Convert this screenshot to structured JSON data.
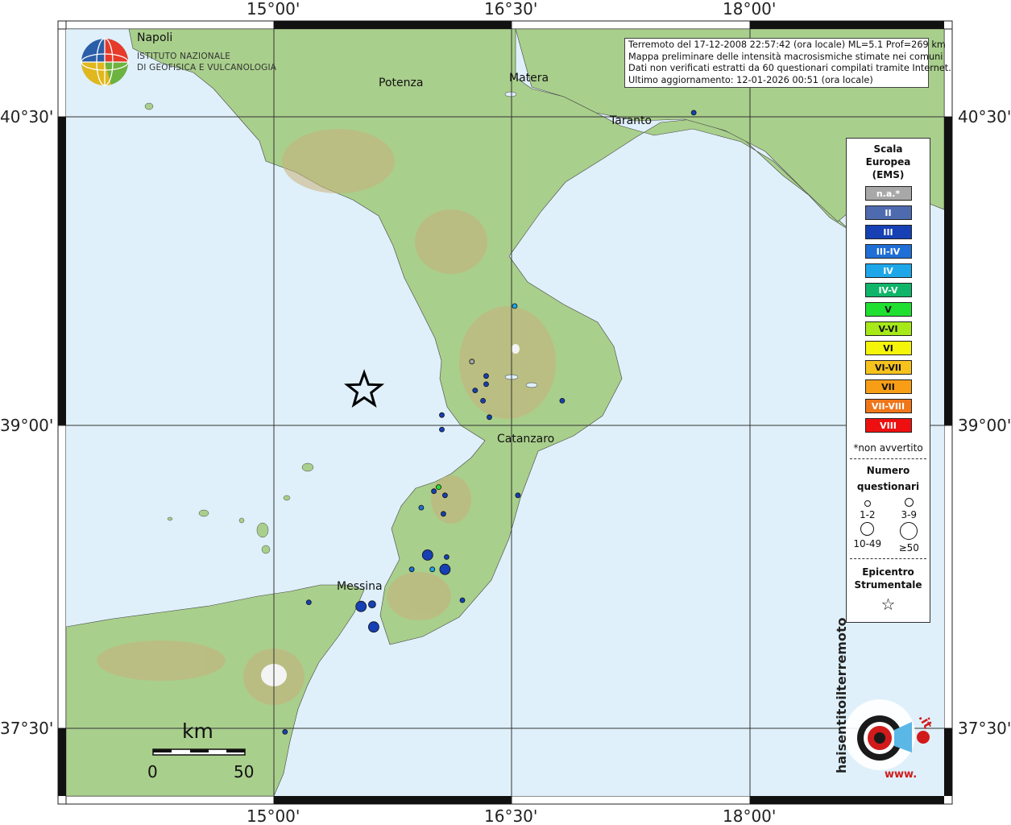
{
  "map": {
    "top_labels": [
      "15°00'",
      "16°30'",
      "18°00'"
    ],
    "bottom_labels": [
      "15°00'",
      "16°30'",
      "18°00'"
    ],
    "left_labels": [
      "40°30'",
      "39°00'",
      "37°30'"
    ],
    "right_labels": [
      "40°30'",
      "39°00'",
      "37°30'"
    ],
    "cities": [
      "Napoli",
      "Potenza",
      "Matera",
      "Taranto",
      "Catanzaro",
      "Messina"
    ],
    "colors": {
      "sea": "#dff0fa",
      "land": "#a9cf8c",
      "highland": "#c9b07a",
      "grid": "#333333",
      "epicenter": "#000000"
    }
  },
  "header": {
    "line1": "Terremoto del 17-12-2008 22:57:42 (ora locale) ML=5.1 Prof=269 km",
    "line2": "Mappa preliminare delle intensità macrosismiche stimate nei comuni",
    "line3": "Dati non verificati estratti da 60 questionari compilati tramite Internet.",
    "line4": "Ultimo aggiornamento: 12-01-2026 00:51 (ora locale)"
  },
  "ingv_logo": {
    "line1": "ISTITUTO NAZIONALE",
    "line2": "DI GEOFISICA E VULCANOLOGIA"
  },
  "legend": {
    "title1": "Scala",
    "title2": "Europea",
    "title3": "(EMS)",
    "scale": [
      {
        "label": "n.a.*",
        "color": "#a8a8a8"
      },
      {
        "label": "II",
        "color": "#4f6bb0"
      },
      {
        "label": "III",
        "color": "#1640b4"
      },
      {
        "label": "III-IV",
        "color": "#1f6fd6"
      },
      {
        "label": "IV",
        "color": "#1ea7e8"
      },
      {
        "label": "IV-V",
        "color": "#10b569"
      },
      {
        "label": "V",
        "color": "#1fe030"
      },
      {
        "label": "V-VI",
        "color": "#a6e818"
      },
      {
        "label": "VI",
        "color": "#f5f50a"
      },
      {
        "label": "VI-VII",
        "color": "#f6c21e"
      },
      {
        "label": "VII",
        "color": "#f79e16"
      },
      {
        "label": "VII-VIII",
        "color": "#f0761a"
      },
      {
        "label": "VIII",
        "color": "#ee1010"
      }
    ],
    "na_note": "*non avvertito",
    "count_title1": "Numero",
    "count_title2": "questionari",
    "counts": [
      "1-2",
      "3-9",
      "10-49",
      "≥50"
    ],
    "epi_title1": "Epicentro",
    "epi_title2": "Strumentale"
  },
  "scale_bar": {
    "unit": "km",
    "left": "0",
    "right": "50"
  },
  "hsit_logo": {
    "text_main": "haisentitoilterremoto",
    "text_it": ".it",
    "text_www": "www."
  },
  "observations": [
    {
      "lon": 17.65,
      "lat": 40.52,
      "intensity": "III",
      "size": "1-2"
    },
    {
      "lon": 16.52,
      "lat": 39.58,
      "intensity": "IV",
      "size": "1-2"
    },
    {
      "lon": 16.25,
      "lat": 39.31,
      "intensity": "n.a.*",
      "size": "1-2"
    },
    {
      "lon": 16.27,
      "lat": 39.17,
      "intensity": "III",
      "size": "1-2"
    },
    {
      "lon": 16.32,
      "lat": 39.12,
      "intensity": "III",
      "size": "1-2"
    },
    {
      "lon": 16.34,
      "lat": 39.2,
      "intensity": "III",
      "size": "1-2"
    },
    {
      "lon": 16.34,
      "lat": 39.24,
      "intensity": "III",
      "size": "1-2"
    },
    {
      "lon": 16.36,
      "lat": 39.04,
      "intensity": "III",
      "size": "1-2"
    },
    {
      "lon": 16.06,
      "lat": 39.05,
      "intensity": "III",
      "size": "1-2"
    },
    {
      "lon": 16.06,
      "lat": 38.98,
      "intensity": "III",
      "size": "1-2"
    },
    {
      "lon": 16.82,
      "lat": 39.12,
      "intensity": "III",
      "size": "1-2"
    },
    {
      "lon": 16.04,
      "lat": 38.7,
      "intensity": "V",
      "size": "1-2"
    },
    {
      "lon": 16.01,
      "lat": 38.68,
      "intensity": "III",
      "size": "1-2"
    },
    {
      "lon": 16.08,
      "lat": 38.66,
      "intensity": "III",
      "size": "1-2"
    },
    {
      "lon": 16.54,
      "lat": 38.66,
      "intensity": "III",
      "size": "1-2"
    },
    {
      "lon": 15.93,
      "lat": 38.6,
      "intensity": "III-IV",
      "size": "1-2"
    },
    {
      "lon": 16.07,
      "lat": 38.57,
      "intensity": "III",
      "size": "1-2"
    },
    {
      "lon": 15.97,
      "lat": 38.37,
      "intensity": "III",
      "size": "10-49"
    },
    {
      "lon": 16.09,
      "lat": 38.36,
      "intensity": "III",
      "size": "1-2"
    },
    {
      "lon": 15.87,
      "lat": 38.3,
      "intensity": "III-IV",
      "size": "1-2"
    },
    {
      "lon": 16.0,
      "lat": 38.3,
      "intensity": "IV",
      "size": "1-2"
    },
    {
      "lon": 16.08,
      "lat": 38.3,
      "intensity": "III",
      "size": "10-49"
    },
    {
      "lon": 16.19,
      "lat": 38.15,
      "intensity": "III",
      "size": "1-2"
    },
    {
      "lon": 15.22,
      "lat": 38.14,
      "intensity": "III",
      "size": "1-2"
    },
    {
      "lon": 15.55,
      "lat": 38.12,
      "intensity": "III",
      "size": "10-49"
    },
    {
      "lon": 15.62,
      "lat": 38.13,
      "intensity": "III",
      "size": "3-9"
    },
    {
      "lon": 15.63,
      "lat": 38.02,
      "intensity": "III",
      "size": "10-49"
    },
    {
      "lon": 15.07,
      "lat": 37.51,
      "intensity": "III",
      "size": "1-2"
    }
  ],
  "epicenter": {
    "lon": 15.57,
    "lat": 39.17
  }
}
